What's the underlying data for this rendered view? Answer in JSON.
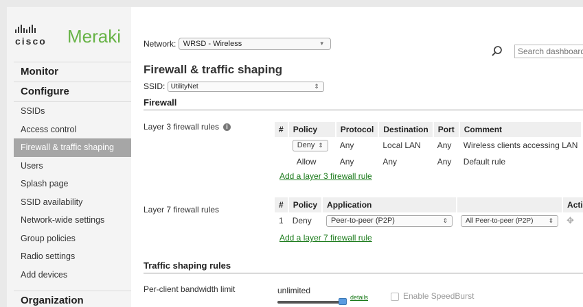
{
  "brand": {
    "cisco": "cisco",
    "meraki": "Meraki",
    "accent": "#67b346"
  },
  "sidebar": {
    "monitor": "Monitor",
    "configure": "Configure",
    "items": [
      {
        "label": "SSIDs",
        "active": false
      },
      {
        "label": "Access control",
        "active": false
      },
      {
        "label": "Firewall & traffic shaping",
        "active": true
      },
      {
        "label": "Users",
        "active": false
      },
      {
        "label": "Splash page",
        "active": false
      },
      {
        "label": "SSID availability",
        "active": false
      },
      {
        "label": "Network-wide settings",
        "active": false
      },
      {
        "label": "Group policies",
        "active": false
      },
      {
        "label": "Radio settings",
        "active": false
      },
      {
        "label": "Add devices",
        "active": false
      }
    ],
    "organization": "Organization"
  },
  "header": {
    "network_label": "Network:",
    "network_value": "WRSD - Wireless",
    "search_placeholder": "Search dashboard"
  },
  "page": {
    "title": "Firewall & traffic shaping",
    "ssid_label": "SSID:",
    "ssid_value": "UtilityNet"
  },
  "firewall": {
    "heading": "Firewall",
    "l3": {
      "label": "Layer 3 firewall rules",
      "info": "i",
      "columns": [
        "#",
        "Policy",
        "Protocol",
        "Destination",
        "Port",
        "Comment"
      ],
      "rows": [
        {
          "num": "",
          "policy": "Deny",
          "protocol": "Any",
          "destination": "Local LAN",
          "port": "Any",
          "comment": "Wireless clients accessing LAN"
        },
        {
          "num": "",
          "policy": "Allow",
          "protocol": "Any",
          "destination": "Any",
          "port": "Any",
          "comment": "Default rule"
        }
      ],
      "add_link": "Add a layer 3 firewall rule"
    },
    "l7": {
      "label": "Layer 7 firewall rules",
      "columns": [
        "#",
        "Policy",
        "Application",
        "",
        "Actions"
      ],
      "rows": [
        {
          "num": "1",
          "policy": "Deny",
          "application": "Peer-to-peer (P2P)",
          "category": "All Peer-to-peer (P2P)"
        }
      ],
      "add_link": "Add a layer 7 firewall rule"
    }
  },
  "traffic": {
    "heading": "Traffic shaping rules",
    "bandwidth_label": "Per-client bandwidth limit",
    "bandwidth_value": "unlimited",
    "details_link": "details",
    "speedburst_label": "Enable SpeedBurst",
    "slider_level": 1.0
  }
}
